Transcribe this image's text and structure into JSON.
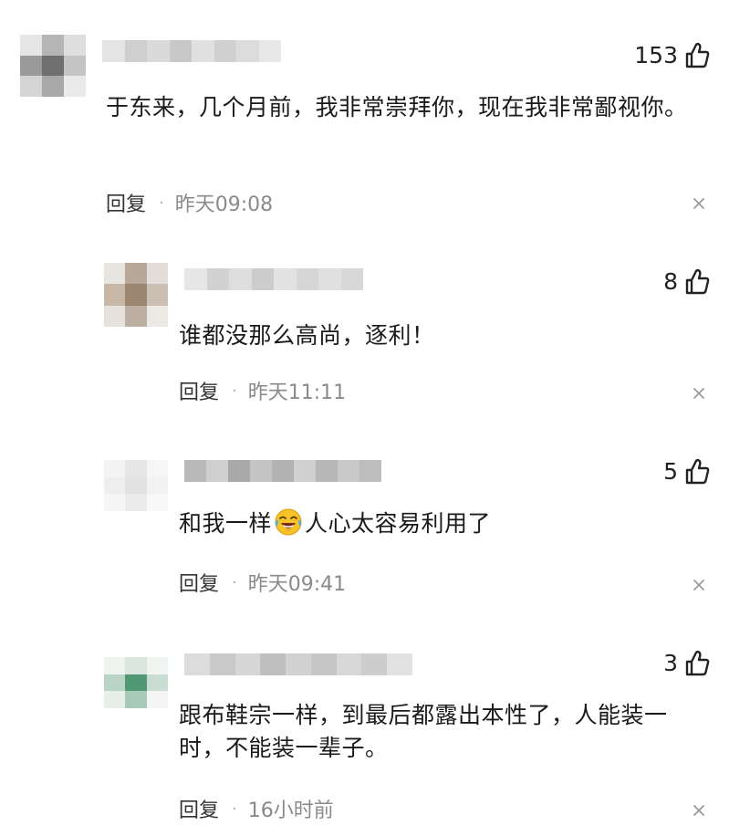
{
  "icons": {
    "like": "thumbs-up-outline-icon",
    "close": "close-x-icon",
    "emoji": "laughing-crying-emoji-icon"
  },
  "colors": {
    "text_primary": "#1a1a1a",
    "text_meta": "#8a8a8a",
    "close_icon": "#9a9a9a",
    "blurred_placeholder": "#d9d9d9"
  },
  "comments": [
    {
      "username": "",
      "likes": "153",
      "text": "于东来，几个月前，我非常崇拜你，现在我非常鄙视你。",
      "reply_label": "回复",
      "separator": "·",
      "time": "昨天09:08"
    },
    {
      "username": "",
      "likes": "8",
      "text": "谁都没那么高尚，逐利！",
      "reply_label": "回复",
      "separator": "·",
      "time": "昨天11:11"
    },
    {
      "username": "",
      "likes": "5",
      "text_before": "和我一样",
      "text_after": "人心太容易利用了",
      "reply_label": "回复",
      "separator": "·",
      "time": "昨天09:41"
    },
    {
      "username": "",
      "likes": "3",
      "text": "跟布鞋宗一样，到最后都露出本性了，人能装一时，不能装一辈子。",
      "reply_label": "回复",
      "separator": "·",
      "time": "16小时前"
    }
  ]
}
